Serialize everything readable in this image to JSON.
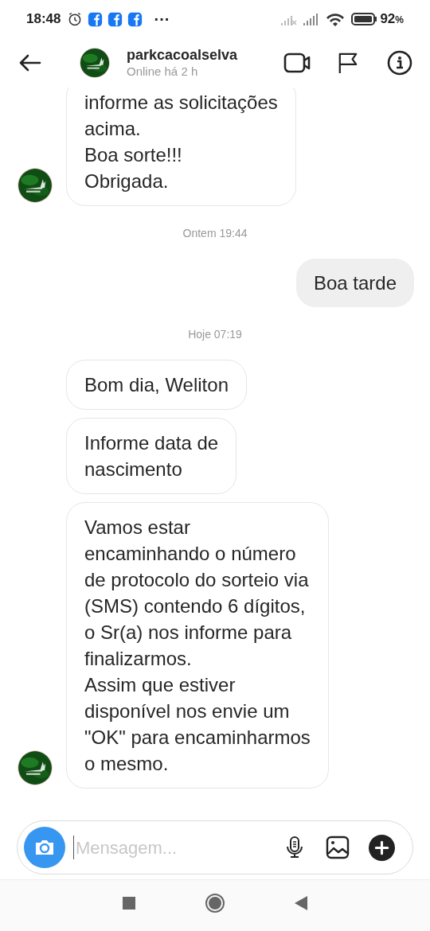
{
  "status_bar": {
    "time": "18:48",
    "overflow": "···",
    "battery": "92",
    "battery_unit": "%"
  },
  "header": {
    "name": "parkcacoalselva",
    "presence": "Online há 2 h"
  },
  "messages": [
    {
      "kind": "incoming",
      "text": "informe as solicitações\nacima.\nBoa sorte!!!\nObrigada.",
      "show_avatar": true
    },
    {
      "kind": "timestamp",
      "text": "Ontem 19:44"
    },
    {
      "kind": "outgoing",
      "text": "Boa tarde"
    },
    {
      "kind": "timestamp",
      "text": "Hoje 07:19"
    },
    {
      "kind": "incoming",
      "text": "Bom dia, Weliton",
      "show_avatar": false
    },
    {
      "kind": "incoming",
      "text": "Informe data de\nnascimento",
      "show_avatar": false
    },
    {
      "kind": "incoming",
      "text": "Vamos estar\nencaminhando o número\nde protocolo do  sorteio via\n(SMS)  contendo 6 dígitos,\no Sr(a) nos informe para\nfinalizarmos.\nAssim que estiver\ndisponível nos envie um\n\"OK\" para encaminharmos\no mesmo.",
      "show_avatar": true
    }
  ],
  "composer": {
    "placeholder": "Mensagem..."
  }
}
